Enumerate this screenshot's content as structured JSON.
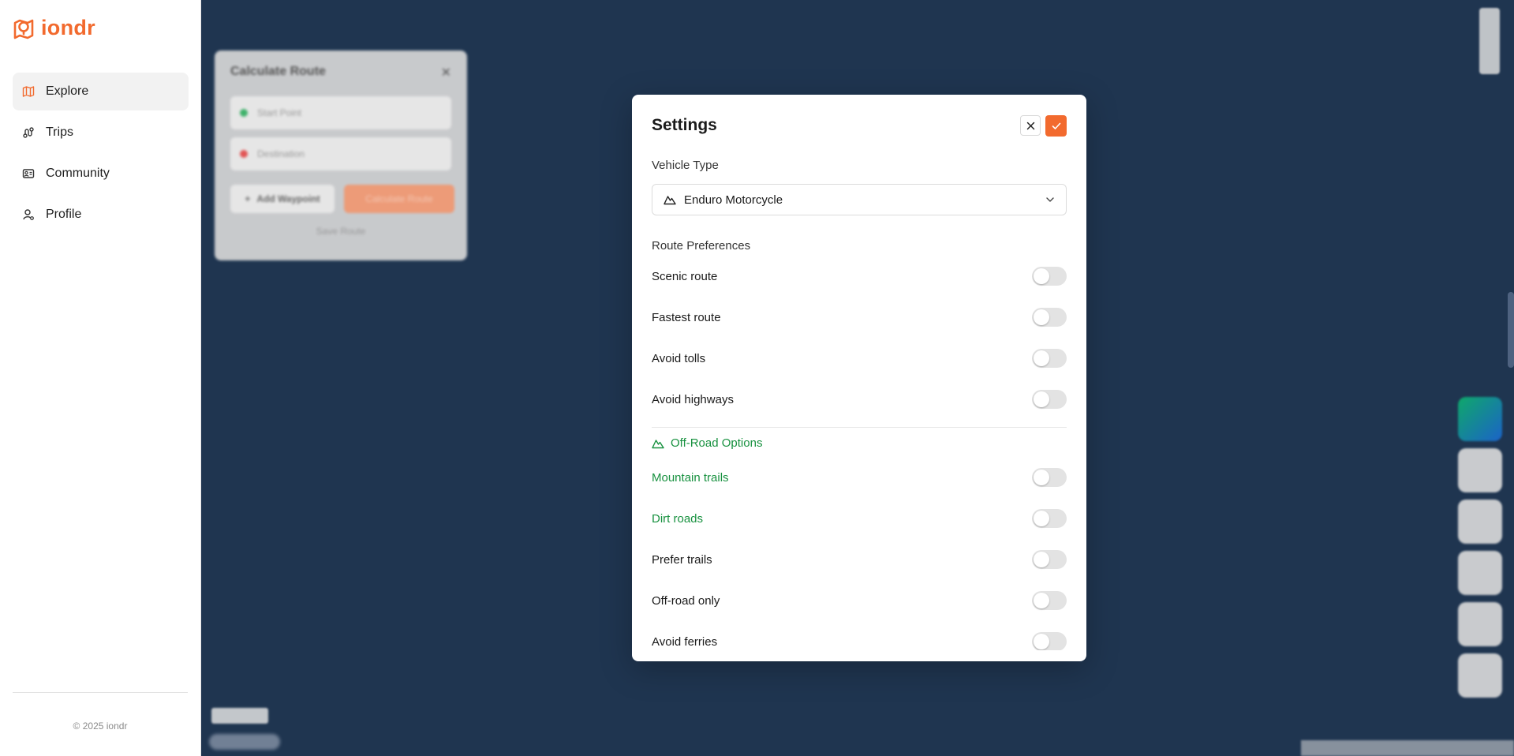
{
  "app": {
    "name": "iondr",
    "brand_color": "#f26a2e",
    "accent_green": "#17913f"
  },
  "sidebar": {
    "items": [
      {
        "label": "Explore",
        "icon": "map-icon",
        "active": true
      },
      {
        "label": "Trips",
        "icon": "route-icon",
        "active": false
      },
      {
        "label": "Community",
        "icon": "community-icon",
        "active": false
      },
      {
        "label": "Profile",
        "icon": "user-icon",
        "active": false
      }
    ],
    "footer": "© 2025 iondr"
  },
  "background_panel": {
    "title": "Calculate Route",
    "start_placeholder": "Start Point",
    "destination_placeholder": "Destination",
    "add_waypoint": "Add Waypoint",
    "calculate": "Calculate Route",
    "save": "Save Route"
  },
  "settings": {
    "title": "Settings",
    "vehicle_type_label": "Vehicle Type",
    "vehicle_type_value": "Enduro Motorcycle",
    "route_preferences_label": "Route Preferences",
    "route_preferences": [
      {
        "label": "Scenic route",
        "on": false
      },
      {
        "label": "Fastest route",
        "on": false
      },
      {
        "label": "Avoid tolls",
        "on": false
      },
      {
        "label": "Avoid highways",
        "on": false
      }
    ],
    "offroad_label": "Off-Road Options",
    "offroad_options": [
      {
        "label": "Mountain trails",
        "on": false,
        "highlight": true
      },
      {
        "label": "Dirt roads",
        "on": false,
        "highlight": true
      },
      {
        "label": "Prefer trails",
        "on": false,
        "highlight": false
      },
      {
        "label": "Off-road only",
        "on": false,
        "highlight": false
      },
      {
        "label": "Avoid ferries",
        "on": false,
        "highlight": false
      }
    ]
  }
}
